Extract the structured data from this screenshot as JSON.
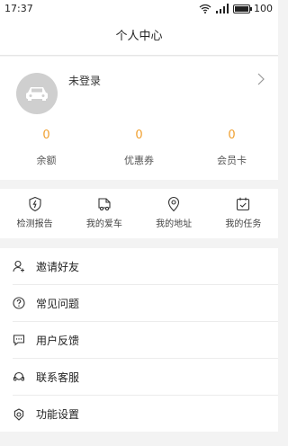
{
  "status_bar": {
    "time": "17:37",
    "battery": "100",
    "battery_level": 1.0
  },
  "header": {
    "title": "个人中心"
  },
  "profile": {
    "login_label": "未登录"
  },
  "stats": [
    {
      "value": "0",
      "label": "余额"
    },
    {
      "value": "0",
      "label": "优惠券"
    },
    {
      "value": "0",
      "label": "会员卡"
    }
  ],
  "shortcuts": [
    {
      "label": "检测报告",
      "icon": "shield-icon"
    },
    {
      "label": "我的爱车",
      "icon": "truck-icon"
    },
    {
      "label": "我的地址",
      "icon": "location-pin-icon"
    },
    {
      "label": "我的任务",
      "icon": "calendar-check-icon"
    }
  ],
  "menu": [
    {
      "label": "邀请好友",
      "icon": "invite-user-icon"
    },
    {
      "label": "常见问题",
      "icon": "question-icon"
    },
    {
      "label": "用户反馈",
      "icon": "feedback-icon"
    },
    {
      "label": "联系客服",
      "icon": "customer-service-icon"
    },
    {
      "label": "功能设置",
      "icon": "settings-icon"
    }
  ],
  "colors": {
    "accent": "#f0a030",
    "page_background": "#f3f3f3",
    "avatar_background": "#cfcfcf"
  }
}
